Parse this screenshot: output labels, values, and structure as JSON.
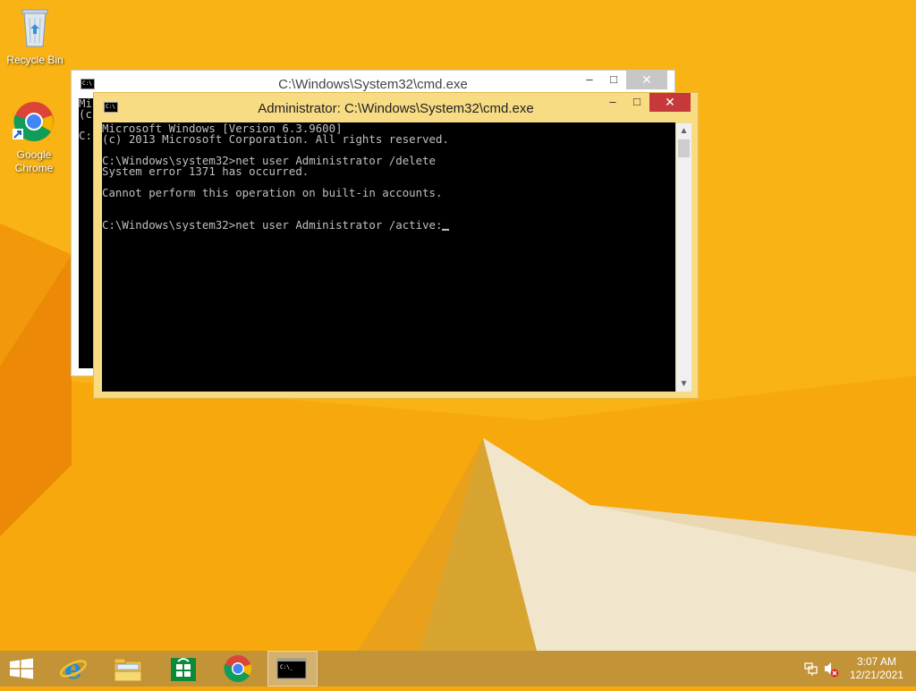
{
  "desktop": {
    "icons": [
      {
        "name": "recycle-bin",
        "label": "Recycle Bin"
      },
      {
        "name": "google-chrome",
        "label_line1": "Google",
        "label_line2": "Chrome"
      }
    ]
  },
  "back_window": {
    "title": "C:\\Windows\\System32\\cmd.exe",
    "console_lines": [
      "Mi",
      "(c",
      "",
      "C:"
    ]
  },
  "front_window": {
    "title": "Administrator: C:\\Windows\\System32\\cmd.exe",
    "console_lines": [
      "Microsoft Windows [Version 6.3.9600]",
      "(c) 2013 Microsoft Corporation. All rights reserved.",
      "",
      "C:\\Windows\\system32>net user Administrator /delete",
      "System error 1371 has occurred.",
      "",
      "Cannot perform this operation on built-in accounts.",
      "",
      "",
      "C:\\Windows\\system32>net user Administrator /active:"
    ]
  },
  "window_buttons": {
    "minimize": "–",
    "maximize": "□",
    "close": "✕"
  },
  "taskbar": {
    "items": [
      "start-button",
      "internet-explorer",
      "file-explorer",
      "windows-store",
      "google-chrome",
      "command-prompt"
    ],
    "active_item": "command-prompt"
  },
  "clock": {
    "time": "3:07 AM",
    "date": "12/21/2021"
  },
  "colors": {
    "wallpaper": "#f7a80c",
    "active_frame": "#f8dc84",
    "inactive_frame": "#ffffff",
    "close_active": "#c7383a",
    "close_inactive": "#c7c7c7",
    "console_bg": "#000000",
    "console_text": "#c0c0c0"
  }
}
